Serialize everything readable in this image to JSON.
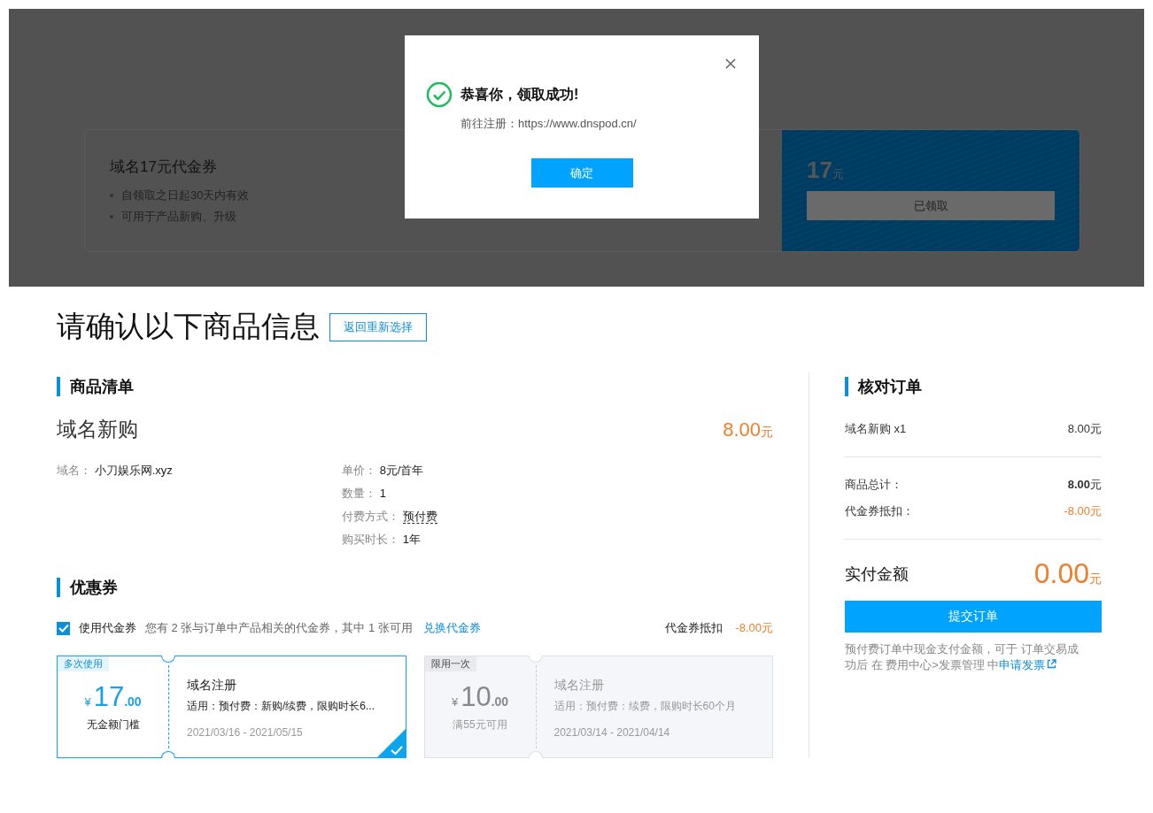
{
  "background_coupon": {
    "title": "域名17元代金券",
    "rules": [
      "自领取之日起30天内有效",
      "可用于产品新购、升级"
    ],
    "amount": "17",
    "unit": "元",
    "button": "已领取"
  },
  "dialog": {
    "title": "恭喜你，领取成功!",
    "message": "前往注册：https://www.dnspod.cn/",
    "confirm_button": "确定"
  },
  "page": {
    "title": "请确认以下商品信息",
    "back_button": "返回重新选择"
  },
  "product_list": {
    "heading": "商品清单",
    "product": {
      "name": "域名新购",
      "price": "8.00",
      "unit": "元"
    },
    "details_left": [
      {
        "label": "域名：",
        "value": "小刀娱乐网.xyz",
        "has_tooltip": false
      }
    ],
    "details_right": [
      {
        "label": "单价：",
        "value": "8元/首年",
        "has_tooltip": false
      },
      {
        "label": "数量：",
        "value": "1",
        "has_tooltip": false
      },
      {
        "label": "付费方式：",
        "value": "预付费",
        "has_tooltip": true
      },
      {
        "label": "购买时长：",
        "value": "1年",
        "has_tooltip": false
      }
    ]
  },
  "coupons": {
    "heading": "优惠券",
    "use_checkbox": {
      "label": "使用代金券",
      "checked": true
    },
    "info": "您有 2 张与订单中产品相关的代金券，其中 1 张可用",
    "link": "兑换代金券",
    "deduction_label": "代金券抵扣",
    "deduction_value": "-8.00元",
    "cards": [
      {
        "tag": "多次使用",
        "currency": "¥",
        "amount": "17",
        "decimals": ".00",
        "condition": "无金额门槛",
        "title": "域名注册",
        "scope": "适用：预付费：新购/续费，限购时长6...",
        "dates": "2021/03/16 - 2021/05/15",
        "selected": true
      },
      {
        "tag": "限用一次",
        "currency": "¥",
        "amount": "10",
        "decimals": ".00",
        "condition": "满55元可用",
        "title": "域名注册",
        "scope": "适用：预付费：续费，限购时长60个月",
        "dates": "2021/03/14 - 2021/04/14",
        "selected": false
      }
    ]
  },
  "order_summary": {
    "heading": "核对订单",
    "item": {
      "name": "域名新购 x1",
      "value": "8.00元"
    },
    "totals": [
      {
        "label": "商品总计：",
        "value": "8.00",
        "unit": "元",
        "kind": "bold"
      },
      {
        "label": "代金券抵扣：",
        "value": "-8.00",
        "unit": "元",
        "kind": "discount"
      }
    ],
    "pay_label": "实付金额",
    "pay_amount": "0.00",
    "pay_unit": "元",
    "submit_button": "提交订单",
    "note": "预付费订单中现金支付金额，可于 订单交易成功后 在 费用中心>发票管理 中",
    "note_link": "申请发票"
  }
}
